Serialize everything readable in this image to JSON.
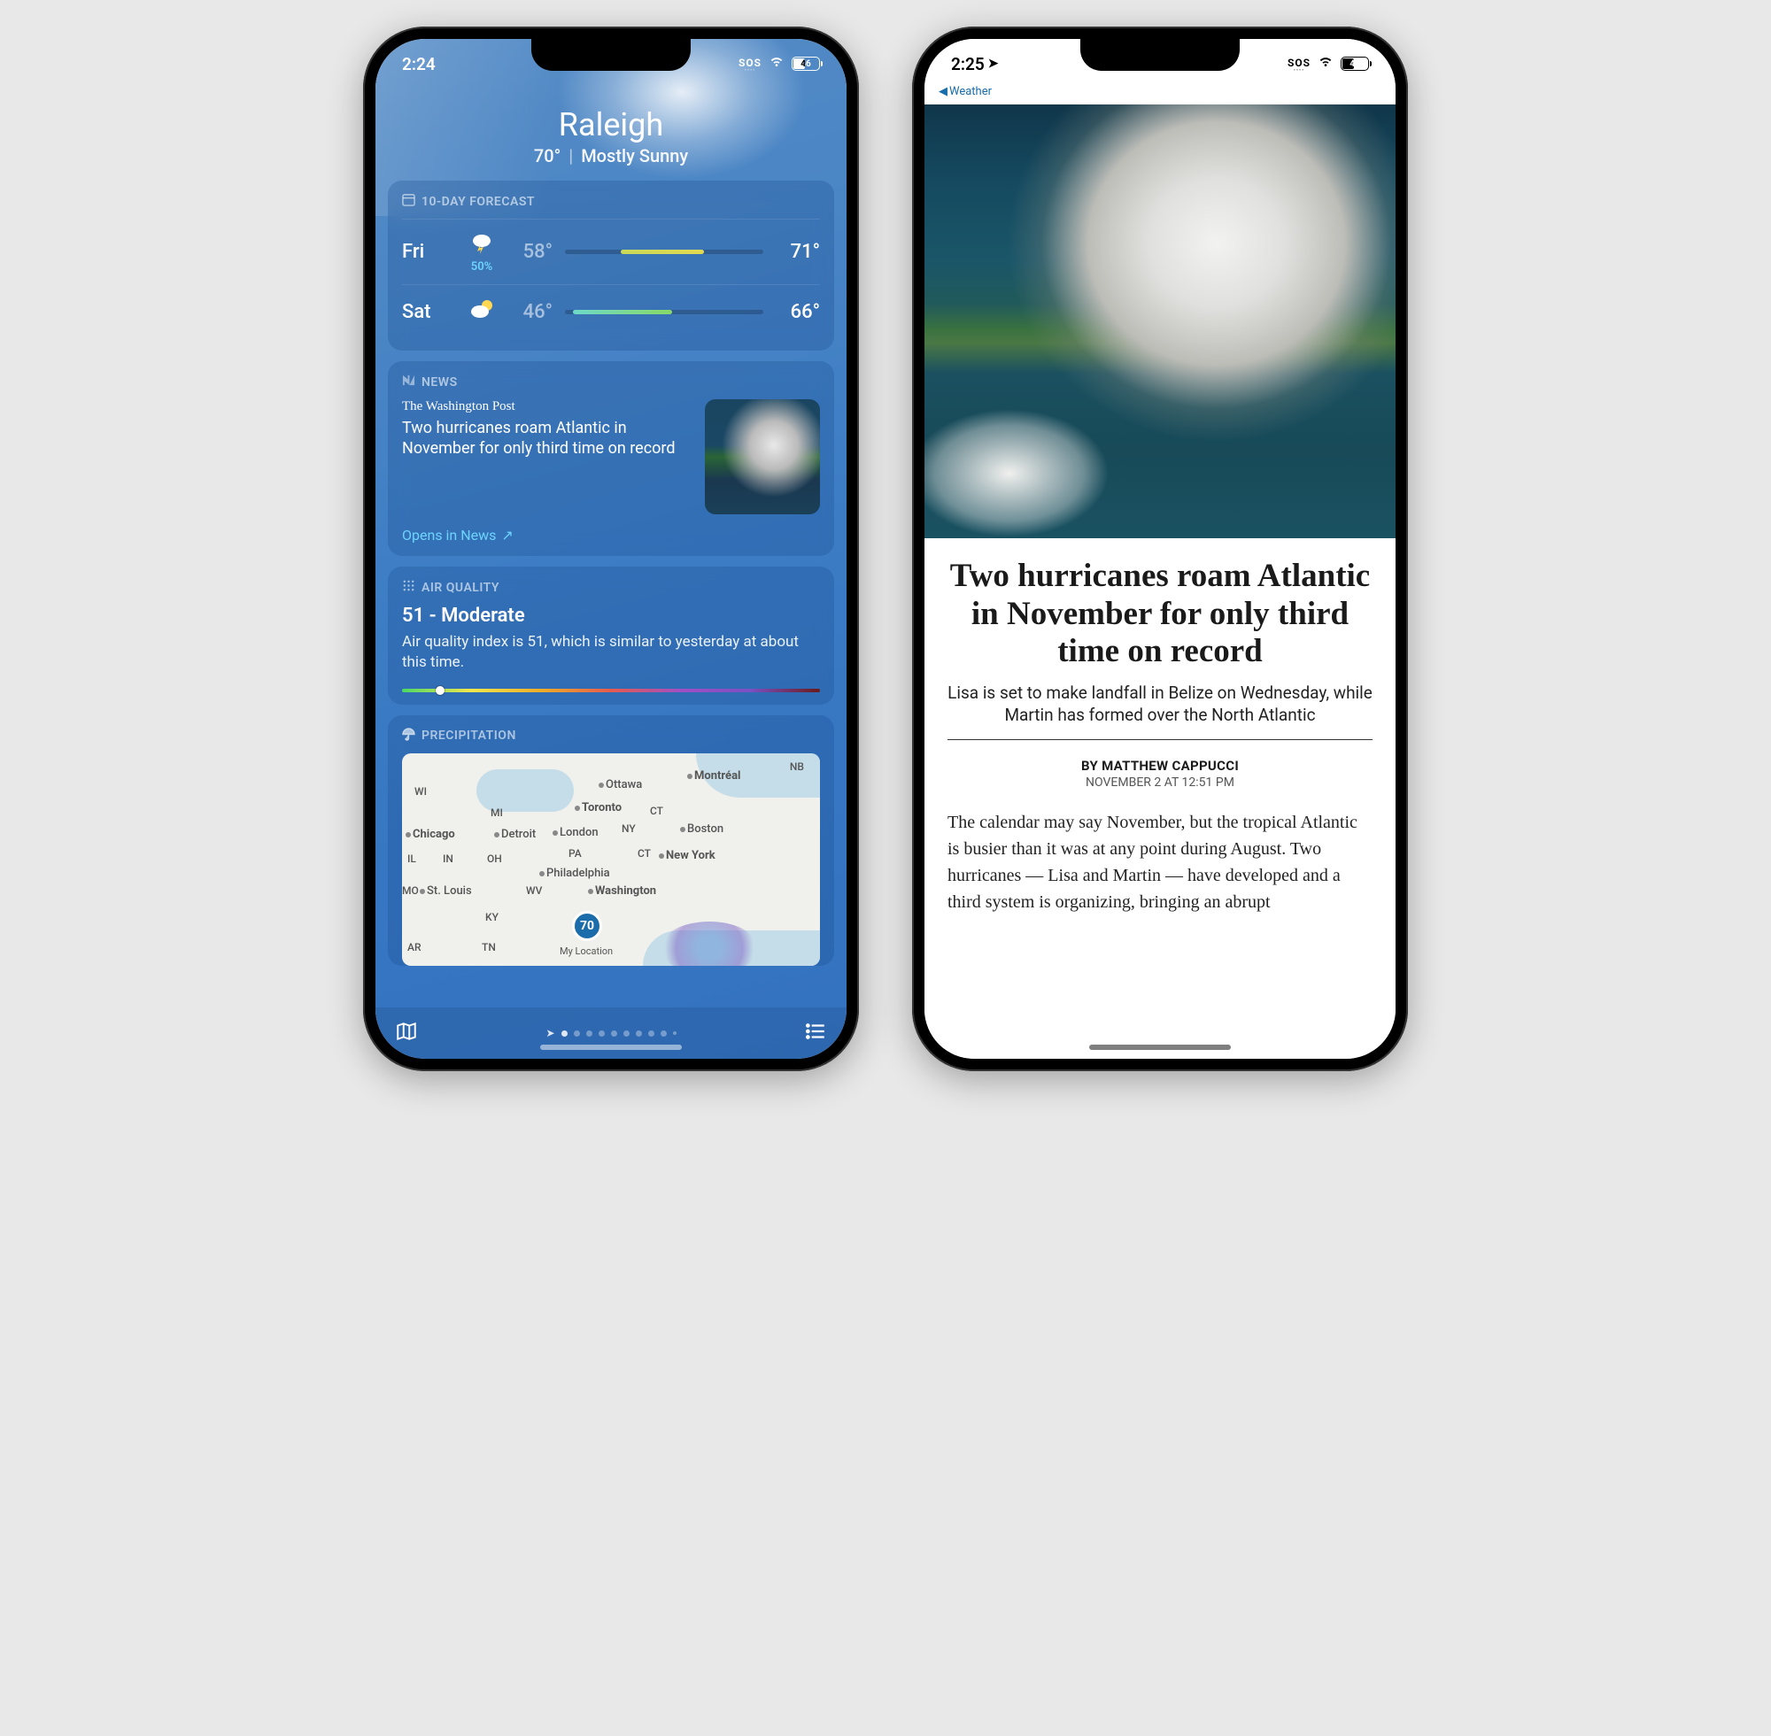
{
  "phone1": {
    "status": {
      "time": "2:24",
      "sos": "SOS",
      "battery": "46"
    },
    "header": {
      "city": "Raleigh",
      "temp": "70°",
      "sep": "|",
      "cond": "Mostly Sunny"
    },
    "forecast": {
      "title": "10-DAY FORECAST",
      "rows": [
        {
          "day": "Fri",
          "pct": "50%",
          "lo": "58°",
          "hi": "71°"
        },
        {
          "day": "Sat",
          "pct": "",
          "lo": "46°",
          "hi": "66°"
        }
      ]
    },
    "news": {
      "title": "NEWS",
      "source": "The Washington Post",
      "headline": "Two hurricanes roam Atlantic in November for only third time on record",
      "cta": "Opens in News"
    },
    "aqi": {
      "title": "AIR QUALITY",
      "value": "51 - Moderate",
      "desc": "Air quality index is 51, which is similar to yesterday at about this time."
    },
    "precip": {
      "title": "PRECIPITATION",
      "pin_value": "70",
      "pin_label": "My Location",
      "labels": {
        "wi": "WI",
        "mi": "MI",
        "il": "IL",
        "in": "IN",
        "oh": "OH",
        "pa": "PA",
        "ct": "CT",
        "mo": "MO",
        "ky": "KY",
        "wv": "WV",
        "ar": "AR",
        "tn": "TN",
        "nb": "NB",
        "ny": "NY",
        "ottawa": "Ottawa",
        "montreal": "Montréal",
        "toronto": "Toronto",
        "london": "London",
        "boston": "Boston",
        "newyork": "New York",
        "philly": "Philadelphia",
        "wash": "Washington",
        "chicago": "Chicago",
        "detroit": "Detroit",
        "stlouis": "St. Louis"
      }
    }
  },
  "phone2": {
    "status": {
      "time": "2:25",
      "sos": "SOS",
      "battery": "45"
    },
    "breadcrumb": "Weather",
    "article": {
      "headline": "Two hurricanes roam Atlantic in November for only third time on record",
      "subhead": "Lisa is set to make landfall in Belize on Wednesday, while Martin has formed over the North Atlantic",
      "by_prefix": "BY ",
      "author": "MATTHEW CAPPUCCI",
      "date": "NOVEMBER 2 AT 12:51 PM",
      "body": "The calendar may say November, but the tropical Atlantic is busier than it was at any point during August. Two hurricanes — Lisa and Martin — have developed and a third system is organizing, bringing an abrupt"
    }
  }
}
